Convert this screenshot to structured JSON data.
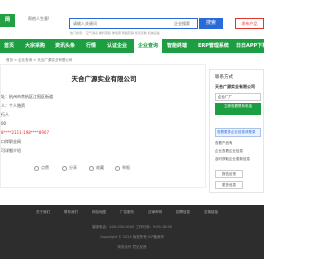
{
  "header": {
    "logo_text": "网",
    "slogan": "帮他人生意!",
    "search_placeholder": "请输入关键词",
    "search_scope": "企业搜索",
    "search_button": "搜索",
    "hotwords": "热门搜索： 空气消毒  塑料薄膜  玻璃钢  网络营销  家具定制  机械设备",
    "publish_button": "发布产品"
  },
  "nav": {
    "items": [
      {
        "label": "首页"
      },
      {
        "label": "大宗采购"
      },
      {
        "label": "资讯头条"
      },
      {
        "label": "行情"
      },
      {
        "label": "认证企业"
      },
      {
        "label": "企业查询"
      },
      {
        "label": "智能终端"
      },
      {
        "label": "ERP管理系统"
      },
      {
        "label": "日日APP下载"
      }
    ]
  },
  "breadcrumb": "首页 > 企业查询 > 天合广源实业有限公司",
  "company": {
    "name": "天合广源实业有限公司",
    "address": "址：杭州市余杭区江阳区街道",
    "legal": "人：个人独资",
    "field3": "行人",
    "field4": "00",
    "phone": "8****2111-198****8907",
    "field6": "口岸职业网",
    "field7": "可详细介绍"
  },
  "actions": {
    "like": "点赞",
    "share": "分享",
    "collect": "收藏",
    "report": "举报"
  },
  "sidebar": {
    "title": "联系方式",
    "company": "天合广源实业有限公司",
    "input_value": "企业厂厂",
    "green_text": "立即查看联系电话",
    "tip": "查看更多企业信息请登录",
    "text1": "查看产品有",
    "text2": "企业查看企业信息",
    "text3": "及时获取企业更新信息",
    "btn1": "报告反馈",
    "btn2": "更多信息"
  },
  "footer": {
    "links": [
      "关于我们",
      "联系我们",
      "网站地图",
      "广告服务",
      "法律声明",
      "招聘信息",
      "友情链接"
    ],
    "line1": "客服电话：400-000-0000  工作时间：9:00-18:00",
    "line2": "Copyright © 2024 版权所有 ICP备案号",
    "line3": "商务合作  意见反馈"
  }
}
